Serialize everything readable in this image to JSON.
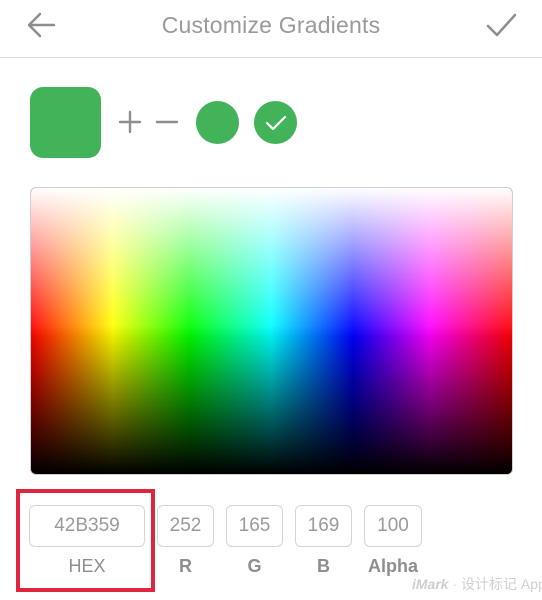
{
  "header": {
    "title": "Customize Gradients",
    "back_icon": "arrow-left-icon",
    "done_icon": "checkmark-icon"
  },
  "swatches": {
    "preview_color": "#42B359",
    "add_icon": "plus-icon",
    "remove_icon": "minus-icon",
    "stops": [
      {
        "color": "#42B359",
        "selected": false
      },
      {
        "color": "#42B359",
        "selected": true
      }
    ]
  },
  "fields": {
    "hex": {
      "value": "42B359",
      "label": "HEX"
    },
    "r": {
      "value": "252",
      "label": "R"
    },
    "g": {
      "value": "165",
      "label": "G"
    },
    "b": {
      "value": "169",
      "label": "B"
    },
    "alpha": {
      "value": "100",
      "label": "Alpha"
    }
  },
  "colors": {
    "highlight": "#E0253F",
    "accent": "#42B359"
  },
  "watermark": {
    "brand": "iMark",
    "suffix": "· 设计标记 App"
  }
}
